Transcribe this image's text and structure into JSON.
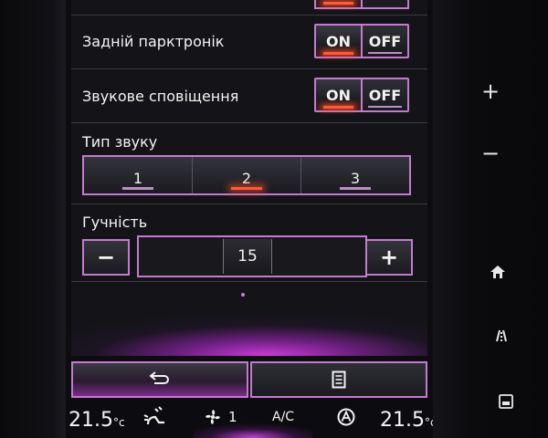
{
  "settings": {
    "rear_parktronic": {
      "label": "Задній парктронік",
      "on": "ON",
      "off": "OFF",
      "state": "on"
    },
    "sound_alert": {
      "label": "Звукове сповіщення",
      "on": "ON",
      "off": "OFF",
      "state": "on"
    },
    "sound_type": {
      "label": "Тип звуку",
      "options": [
        "1",
        "2",
        "3"
      ],
      "selected": "2"
    },
    "volume": {
      "label": "Гучність",
      "minus": "−",
      "plus": "+",
      "value": "15"
    }
  },
  "bottom_bar": {
    "back_icon": "back-arrow-icon",
    "menu_icon": "list-menu-icon"
  },
  "climate": {
    "left_temp": "21.5",
    "right_temp": "21.5",
    "unit": "°c",
    "fan_level": "1",
    "ac_label": "A/C"
  },
  "hardware": {
    "plus": "+",
    "minus": "−"
  },
  "colors": {
    "accent": "#c37bd0",
    "active_glow": "#ff5a3a",
    "ambient": "#d63ce6"
  }
}
